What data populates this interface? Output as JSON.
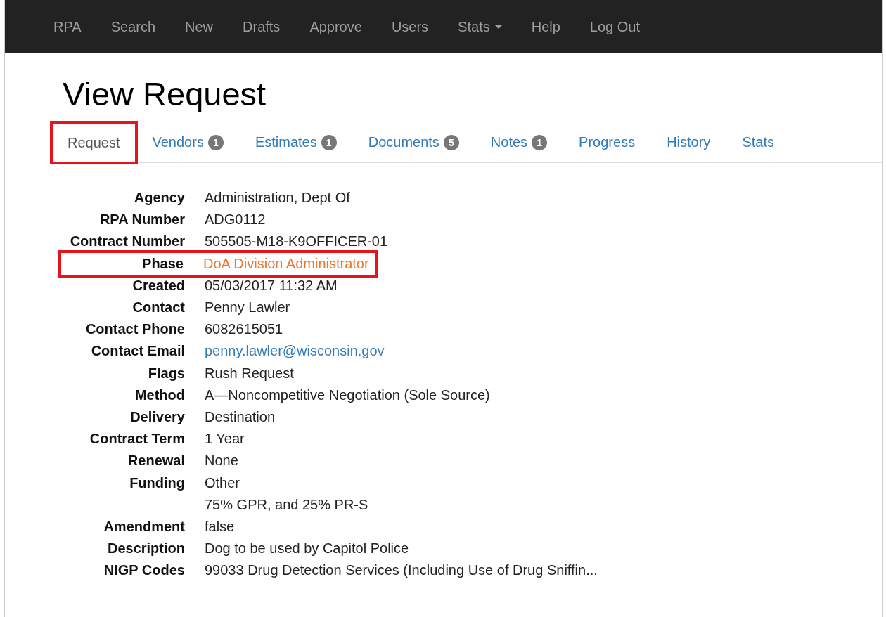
{
  "navbar": {
    "items": [
      {
        "label": "RPA",
        "dropdown": false
      },
      {
        "label": "Search",
        "dropdown": false
      },
      {
        "label": "New",
        "dropdown": false
      },
      {
        "label": "Drafts",
        "dropdown": false
      },
      {
        "label": "Approve",
        "dropdown": false
      },
      {
        "label": "Users",
        "dropdown": false
      },
      {
        "label": "Stats",
        "dropdown": true
      },
      {
        "label": "Help",
        "dropdown": false
      },
      {
        "label": "Log Out",
        "dropdown": false
      }
    ]
  },
  "page_title": "View Request",
  "tabs": [
    {
      "label": "Request",
      "selected": true,
      "highlighted": true
    },
    {
      "label": "Vendors",
      "badge": "1",
      "selected": false,
      "highlighted": false
    },
    {
      "label": "Estimates",
      "badge": "1",
      "selected": false,
      "highlighted": false
    },
    {
      "label": "Documents",
      "badge": "5",
      "selected": false,
      "highlighted": false
    },
    {
      "label": "Notes",
      "badge": "1",
      "selected": false,
      "highlighted": false
    },
    {
      "label": "Progress",
      "selected": false,
      "highlighted": false
    },
    {
      "label": "History",
      "selected": false,
      "highlighted": false
    },
    {
      "label": "Stats",
      "selected": false,
      "highlighted": false
    }
  ],
  "fields": [
    {
      "label": "Agency",
      "value": "Administration, Dept Of",
      "kind": "text",
      "highlighted": false
    },
    {
      "label": "RPA Number",
      "value": "ADG0112",
      "kind": "text",
      "highlighted": false
    },
    {
      "label": "Contract Number",
      "value": "505505-M18-K9OFFICER-01",
      "kind": "text",
      "highlighted": false
    },
    {
      "label": "Phase",
      "value": "DoA Division Administrator",
      "kind": "status",
      "highlighted": true
    },
    {
      "label": "Created",
      "value": "05/03/2017 11:32 AM",
      "kind": "text",
      "highlighted": false
    },
    {
      "label": "Contact",
      "value": "Penny Lawler",
      "kind": "text",
      "highlighted": false
    },
    {
      "label": "Contact Phone",
      "value": "6082615051",
      "kind": "text",
      "highlighted": false
    },
    {
      "label": "Contact Email",
      "value": "penny.lawler@wisconsin.gov",
      "kind": "link",
      "highlighted": false
    },
    {
      "label": "Flags",
      "value": "Rush Request",
      "kind": "text",
      "highlighted": false
    },
    {
      "label": "Method",
      "value": "A—Noncompetitive Negotiation (Sole Source)",
      "kind": "text",
      "highlighted": false
    },
    {
      "label": "Delivery",
      "value": "Destination",
      "kind": "text",
      "highlighted": false
    },
    {
      "label": "Contract Term",
      "value": "1 Year",
      "kind": "text",
      "highlighted": false
    },
    {
      "label": "Renewal",
      "value": "None",
      "kind": "text",
      "highlighted": false
    },
    {
      "label": "Funding",
      "value": "Other",
      "kind": "text",
      "highlighted": false
    },
    {
      "value": "75% GPR, and 25% PR-S",
      "kind": "text",
      "highlighted": false
    },
    {
      "label": "Amendment",
      "value": "false",
      "kind": "text",
      "highlighted": false
    },
    {
      "label": "Description",
      "value": "Dog to be used by Capitol Police",
      "kind": "text",
      "highlighted": false
    },
    {
      "label": "NIGP Codes",
      "value": "99033 Drug Detection Services (Including Use of Drug Sniffin...",
      "kind": "text",
      "highlighted": false
    }
  ]
}
